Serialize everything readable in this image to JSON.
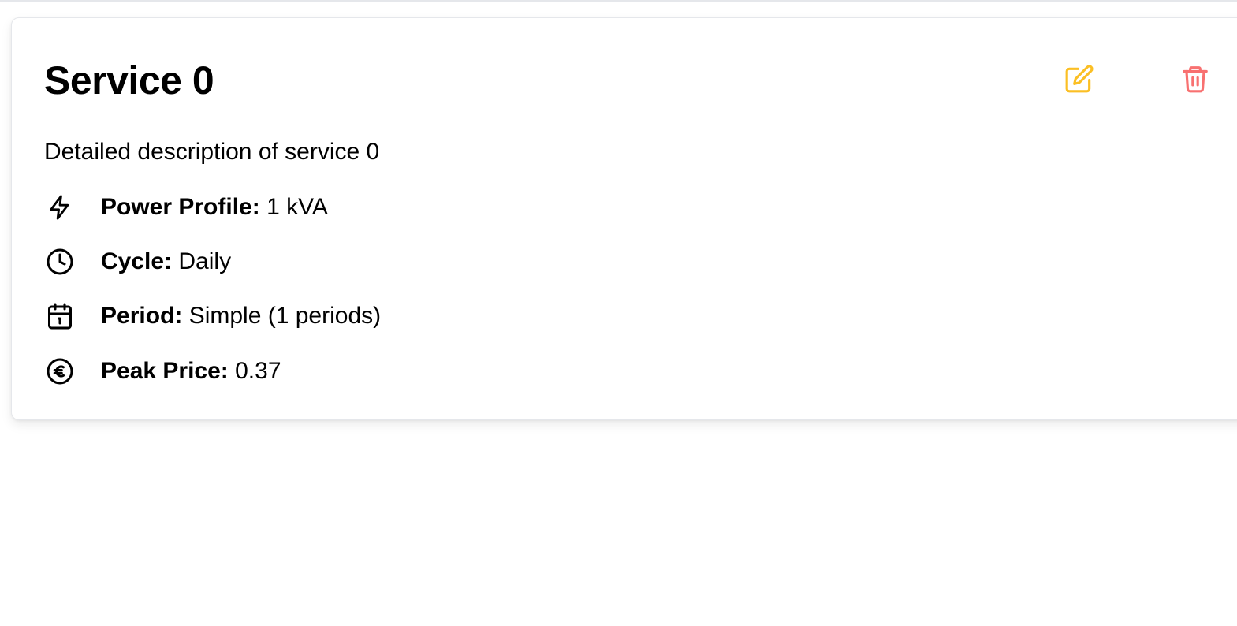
{
  "service": {
    "title": "Service 0",
    "description": "Detailed description of service 0",
    "actions": {
      "edit_icon": "pencil-square-icon",
      "delete_icon": "trash-icon",
      "edit_color": "#fbbf24",
      "delete_color": "#f87171"
    },
    "details": [
      {
        "icon": "bolt-icon",
        "label": "Power Profile:",
        "value": "1 kVA"
      },
      {
        "icon": "clock-icon",
        "label": "Cycle:",
        "value": "Daily"
      },
      {
        "icon": "calendar-icon",
        "label": "Period:",
        "value": "Simple (1 periods)"
      },
      {
        "icon": "euro-icon",
        "label": "Peak Price:",
        "value": "0.37"
      }
    ]
  }
}
